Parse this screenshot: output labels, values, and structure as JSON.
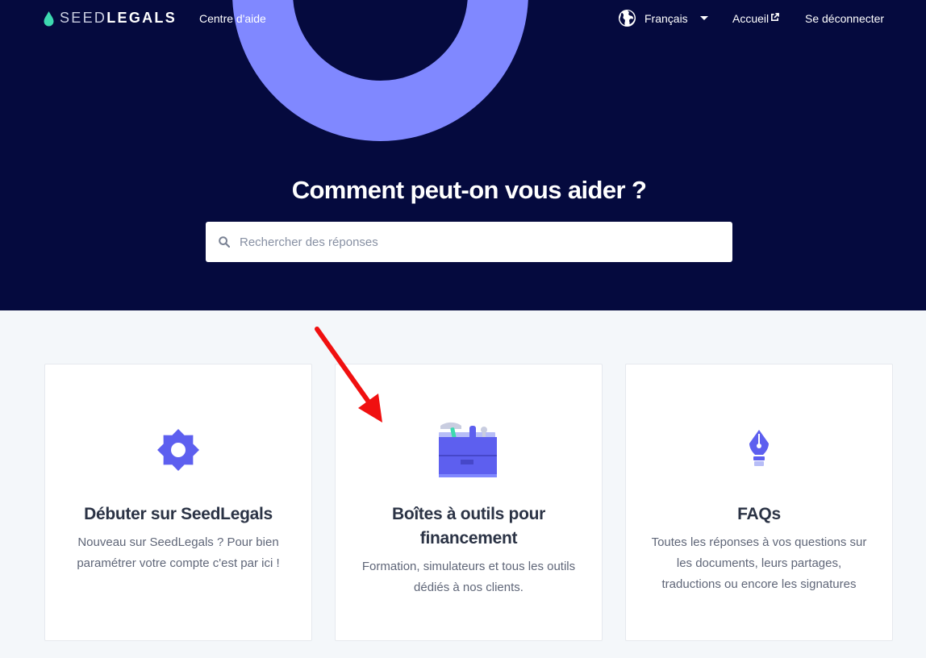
{
  "header": {
    "logo": {
      "light": "SEED",
      "bold": "LEGALS",
      "icon": "seed-drop-icon"
    },
    "help_center": "Centre d'aide",
    "language": {
      "selected": "Français",
      "icon": "globe-icon"
    },
    "home_link": "Accueil",
    "logout_link": "Se déconnecter"
  },
  "hero": {
    "title": "Comment peut-on vous aider ?",
    "search_placeholder": "Rechercher des réponses"
  },
  "cards": [
    {
      "icon": "gear-icon",
      "title": "Débuter sur SeedLegals",
      "description": "Nouveau sur SeedLegals ? Pour bien paramétrer votre compte c'est par ici !"
    },
    {
      "icon": "toolbox-icon",
      "title": "Boîtes à outils pour financement",
      "description": "Formation, simulateurs et tous les outils dédiés à nos clients."
    },
    {
      "icon": "fountain-pen-icon",
      "title": "FAQs",
      "description": "Toutes les réponses à vos questions sur les documents, leurs partages, traductions ou encore les signatures"
    }
  ],
  "colors": {
    "hero_bg": "#050a3e",
    "accent": "#8088ff",
    "icon": "#5d5fef",
    "logo_drop": "#3dd9b0",
    "annotation_arrow": "#f01010"
  }
}
